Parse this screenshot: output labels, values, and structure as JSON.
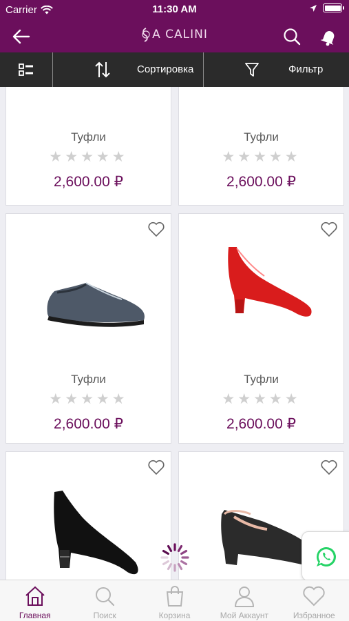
{
  "status": {
    "carrier": "Carrier",
    "time": "11:30 AM"
  },
  "header": {
    "logo_text": "A CALINI"
  },
  "toolbar": {
    "sort_label": "Сортировка",
    "filter_label": "Фильтр"
  },
  "products": [
    {
      "name": "Туфли",
      "price": "2,600.00 ₽",
      "rating": 0
    },
    {
      "name": "Туфли",
      "price": "2,600.00 ₽",
      "rating": 0
    },
    {
      "name": "Туфли",
      "price": "2,600.00 ₽",
      "rating": 0
    },
    {
      "name": "Туфли",
      "price": "2,600.00 ₽",
      "rating": 0
    }
  ],
  "stars": "★★★★★",
  "tabs": [
    {
      "label": "Главная",
      "icon": "home-icon",
      "active": true
    },
    {
      "label": "Поиск",
      "icon": "search-icon",
      "active": false
    },
    {
      "label": "Корзина",
      "icon": "bag-icon",
      "active": false
    },
    {
      "label": "Мой Аккаунт",
      "icon": "user-icon",
      "active": false
    },
    {
      "label": "Избранное",
      "icon": "heart-icon",
      "active": false
    }
  ],
  "colors": {
    "brand": "#6b0f5c",
    "toolbar": "#2b2b2b",
    "star": "#cfcfcf",
    "whatsapp": "#25d366"
  }
}
